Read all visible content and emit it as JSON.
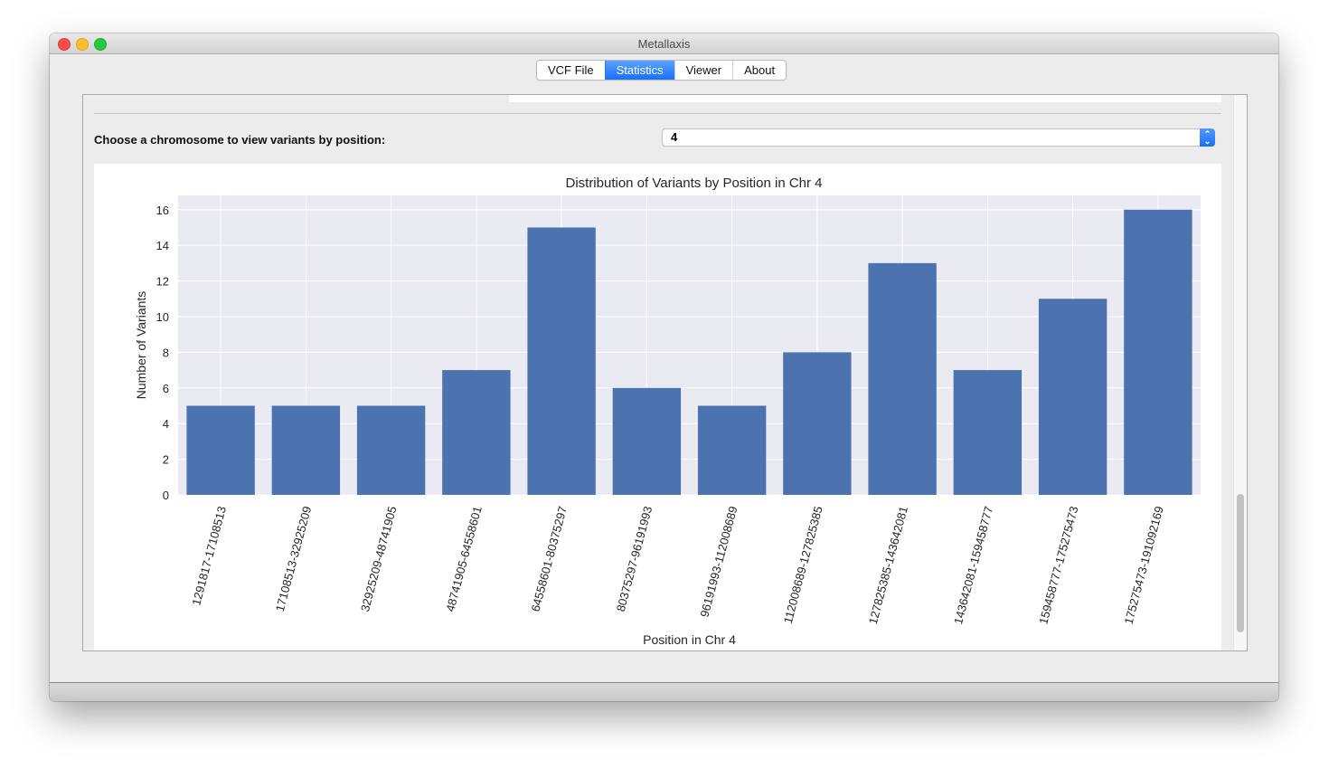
{
  "window": {
    "title": "Metallaxis"
  },
  "tabs": [
    {
      "label": "VCF File",
      "active": false
    },
    {
      "label": "Statistics",
      "active": true
    },
    {
      "label": "Viewer",
      "active": false
    },
    {
      "label": "About",
      "active": false
    }
  ],
  "controls": {
    "chromosome_label": "Choose a chromosome to view variants by position:",
    "chromosome_value": "4",
    "stepper_icon": "up-down-chevron"
  },
  "colors": {
    "bar": "#4c72b0",
    "plot_bg": "#eaeaf2",
    "grid": "#ffffff",
    "accent": "#1a6ff5"
  },
  "chart_data": {
    "type": "bar",
    "title": "Distribution of Variants by Position in Chr 4",
    "xlabel": "Position in Chr 4",
    "ylabel": "Number of Variants",
    "ylim": [
      0,
      16.8
    ],
    "yticks": [
      0,
      2,
      4,
      6,
      8,
      10,
      12,
      14,
      16
    ],
    "grid": true,
    "categories": [
      "1291817-17108513",
      "17108513-32925209",
      "32925209-48741905",
      "48741905-64558601",
      "64558601-80375297",
      "80375297-96191993",
      "96191993-112008689",
      "112008689-127825385",
      "127825385-143642081",
      "143642081-159458777",
      "159458777-175275473",
      "175275473-191092169"
    ],
    "values": [
      5,
      5,
      5,
      7,
      15,
      6,
      5,
      8,
      13,
      7,
      11,
      16
    ],
    "xtick_rotation_deg": 75
  }
}
